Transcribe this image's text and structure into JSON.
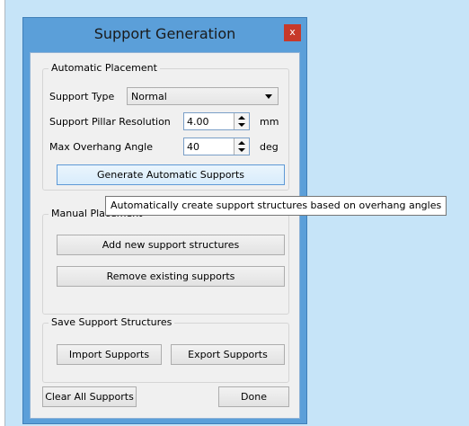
{
  "dialog": {
    "title": "Support Generation",
    "close_glyph": "x"
  },
  "automatic": {
    "group_label": "Automatic Placement",
    "support_type_label": "Support Type",
    "support_type_value": "Normal",
    "pillar_resolution_label": "Support Pillar Resolution",
    "pillar_resolution_value": "4.00",
    "pillar_resolution_unit": "mm",
    "overhang_label": "Max Overhang Angle",
    "overhang_value": "40",
    "overhang_unit": "deg",
    "generate_button": "Generate Automatic Supports"
  },
  "tooltip": {
    "text": "Automatically create support structures based on overhang angles"
  },
  "manual": {
    "group_label": "Manual Placement",
    "add_button": "Add new support structures",
    "remove_button": "Remove existing supports"
  },
  "save": {
    "group_label": "Save Support Structures",
    "import_button": "Import Supports",
    "export_button": "Export Supports"
  },
  "footer": {
    "clear_button": "Clear All Supports",
    "done_button": "Done"
  },
  "colors": {
    "window_frame": "#5b9fd9",
    "close_button": "#c7392a",
    "canvas": "#c6e4f8"
  }
}
